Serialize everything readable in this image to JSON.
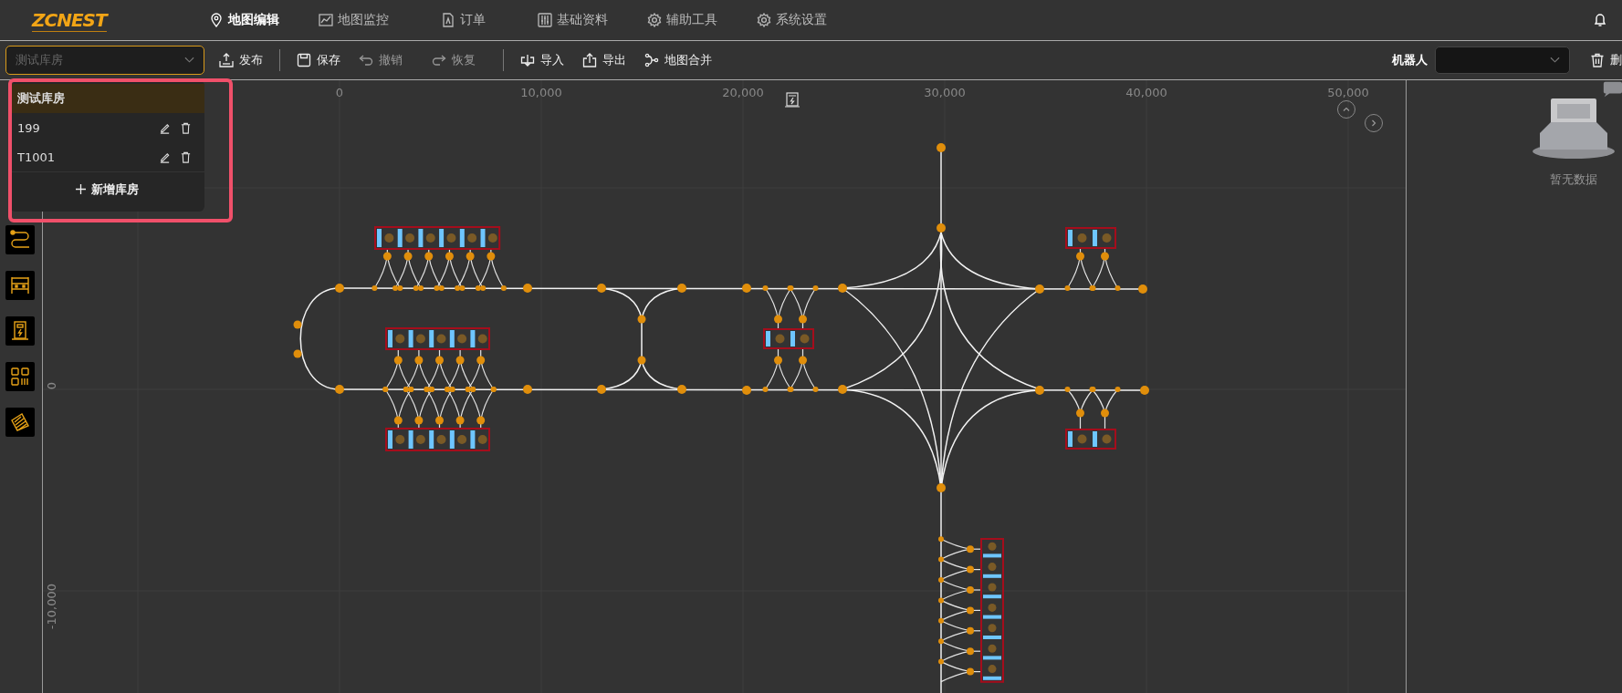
{
  "header": {
    "logo": "ZCNEST",
    "nav": [
      {
        "label": "地图编辑",
        "selected": true
      },
      {
        "label": "地图监控",
        "selected": false
      },
      {
        "label": "订单",
        "selected": false
      },
      {
        "label": "基础资料",
        "selected": false
      },
      {
        "label": "辅助工具",
        "selected": false
      },
      {
        "label": "系统设置",
        "selected": false
      }
    ]
  },
  "toolbar": {
    "warehouse_select": {
      "placeholder": "测试库房"
    },
    "groups": [
      [
        {
          "label": "发布",
          "kind": "publish",
          "disabled": false
        }
      ],
      [
        {
          "label": "保存",
          "kind": "save",
          "disabled": false
        },
        {
          "label": "撤销",
          "kind": "undo",
          "disabled": true
        },
        {
          "label": "恢复",
          "kind": "redo",
          "disabled": true
        }
      ],
      [
        {
          "label": "导入",
          "kind": "import",
          "disabled": false
        },
        {
          "label": "导出",
          "kind": "export",
          "disabled": false
        },
        {
          "label": "地图合并",
          "kind": "merge",
          "disabled": false
        }
      ]
    ],
    "robot": {
      "label": "机器人"
    },
    "delete": {
      "label": "删"
    }
  },
  "warehouse_menu": {
    "items": [
      {
        "label": "测试库房",
        "kind": "group",
        "selected": true
      },
      {
        "label": "199",
        "kind": "item",
        "selected": false
      },
      {
        "label": "T1001",
        "kind": "item",
        "selected": false
      }
    ],
    "add": {
      "label": "新增库房"
    }
  },
  "tools": [
    {
      "kind": "route"
    },
    {
      "kind": "shelf"
    },
    {
      "kind": "charger"
    },
    {
      "kind": "qr"
    },
    {
      "kind": "area"
    }
  ],
  "map": {
    "x_labels": [
      "0",
      "10,000",
      "20,000",
      "30,000",
      "40,000",
      "50,000"
    ],
    "y_labels": [
      "0",
      "-10,000"
    ]
  },
  "right_panel": {
    "empty_text": "暂无数据"
  }
}
